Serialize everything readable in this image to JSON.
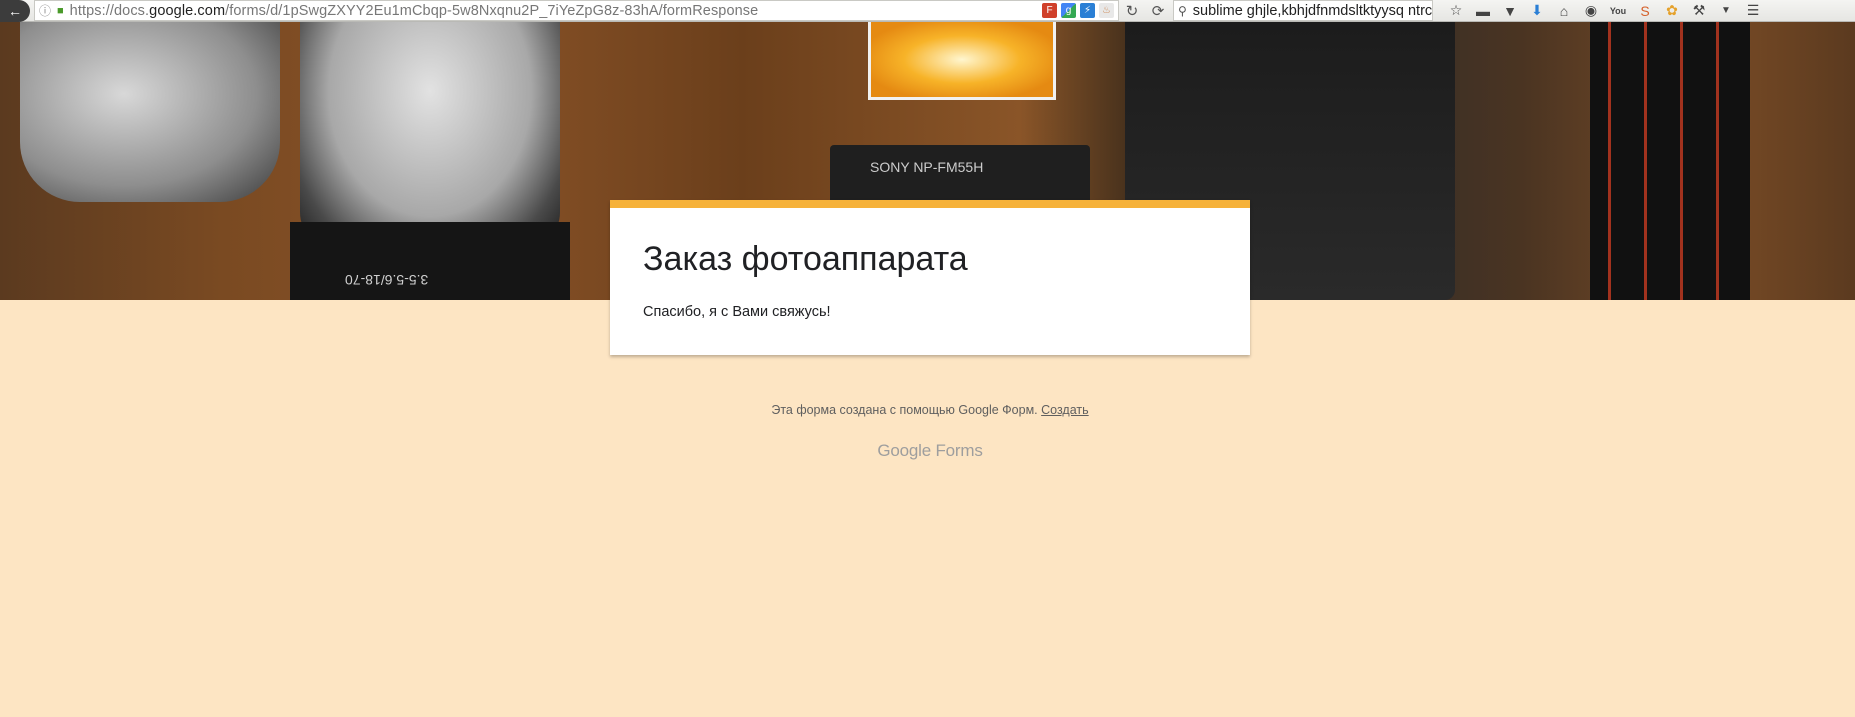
{
  "browser": {
    "url_prefix": "https://docs.",
    "url_domain": "google.com",
    "url_path": "/forms/d/1pSwgZXYY2Eu1mCbqp-5w8Nxqnu2P_7iYeZpG8z-83hA/formResponse",
    "search_text": "sublime ghjle,kbhjdfnmdsltktyysq ntrcn",
    "icons": {
      "back": "back-arrow-icon",
      "reload": "reload-icon"
    }
  },
  "form": {
    "title": "Заказ фотоаппарата",
    "confirmation": "Спасибо, я с Вами свяжусь!",
    "accent_color": "#f6b23a",
    "background_color": "#fde5c3"
  },
  "footer": {
    "note": "Эта форма создана с помощью Google Форм.",
    "create_link": "Создать",
    "logo_google": "Google",
    "logo_forms": "Forms"
  },
  "banner": {
    "battery_label": "SONY NP-FM55H",
    "lens_label": "3.5-5.6/18-70"
  }
}
